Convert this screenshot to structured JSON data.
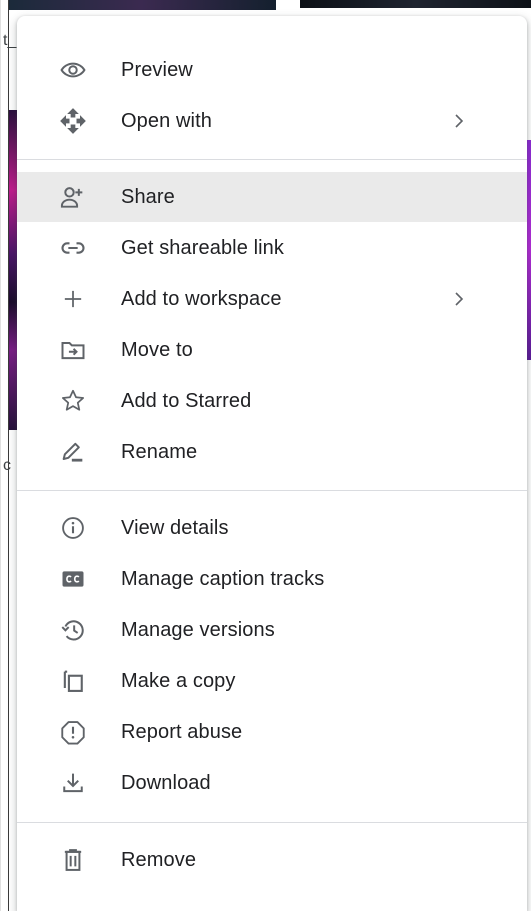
{
  "background": {
    "fragment_left_top": "t_",
    "fragment_left_mid": "c"
  },
  "menu": {
    "groups": [
      [
        {
          "label": "Preview",
          "icon": "eye-icon"
        },
        {
          "label": "Open with",
          "icon": "open-with-icon",
          "submenu": true
        }
      ],
      [
        {
          "label": "Share",
          "icon": "person-add-icon",
          "highlighted": true
        },
        {
          "label": "Get shareable link",
          "icon": "link-icon"
        },
        {
          "label": "Add to workspace",
          "icon": "plus-icon",
          "submenu": true
        },
        {
          "label": "Move to",
          "icon": "folder-move-icon"
        },
        {
          "label": "Add to Starred",
          "icon": "star-icon"
        },
        {
          "label": "Rename",
          "icon": "pencil-icon"
        }
      ],
      [
        {
          "label": "View details",
          "icon": "info-icon"
        },
        {
          "label": "Manage caption tracks",
          "icon": "closed-caption-icon"
        },
        {
          "label": "Manage versions",
          "icon": "history-icon"
        },
        {
          "label": "Make a copy",
          "icon": "copy-icon"
        },
        {
          "label": "Report abuse",
          "icon": "report-icon"
        },
        {
          "label": "Download",
          "icon": "download-icon"
        }
      ],
      [
        {
          "label": "Remove",
          "icon": "trash-icon"
        }
      ]
    ]
  },
  "colors": {
    "text": "#202124",
    "icon": "#5f6368",
    "hover": "#eaeaea",
    "divider": "#dadce0"
  }
}
